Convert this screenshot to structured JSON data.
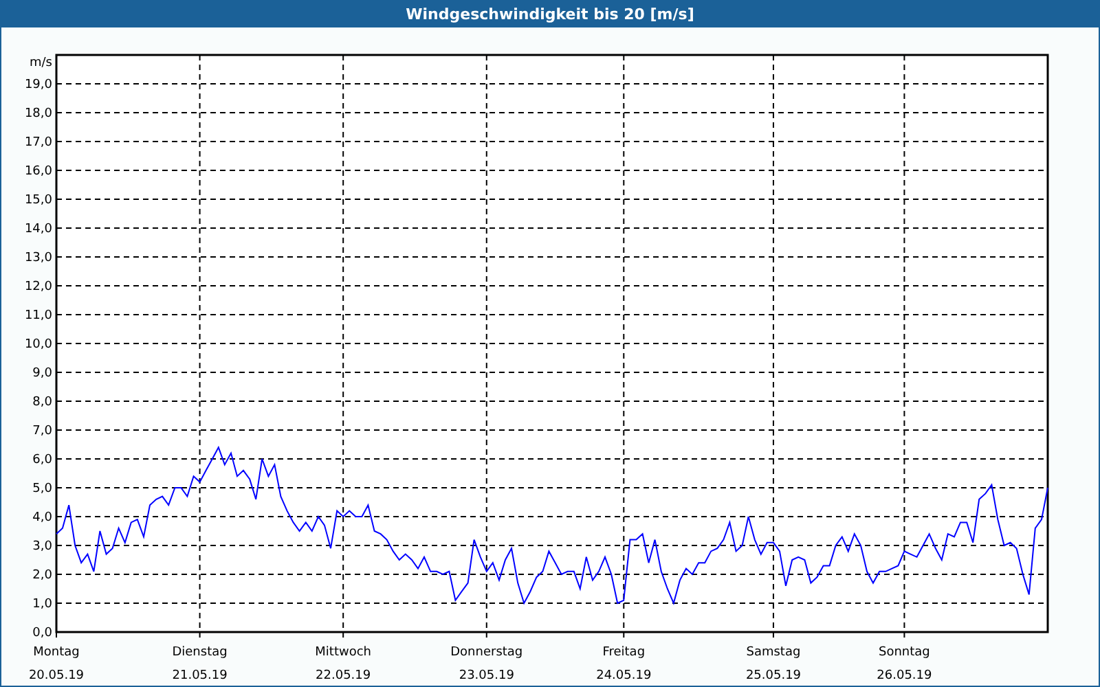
{
  "window": {
    "title": "Windgeschwindigkeit bis 20 [m/s]"
  },
  "chart": {
    "day_labels": [
      "Montag",
      "Dienstag",
      "Mittwoch",
      "Donnerstag",
      "Freitag",
      "Samstag",
      "Sonntag"
    ],
    "chart_data": {
      "type": "line",
      "ylabel": "m/s",
      "ylim": [
        0,
        20
      ],
      "grid": true,
      "categories": [
        "20.05.19",
        null,
        null,
        null,
        null,
        null,
        null,
        null,
        null,
        null,
        null,
        null,
        null,
        null,
        null,
        null,
        null,
        null,
        null,
        null,
        null,
        null,
        null,
        "21.05.19",
        null,
        null,
        null,
        null,
        null,
        null,
        null,
        null,
        null,
        null,
        null,
        null,
        null,
        null,
        null,
        null,
        null,
        null,
        null,
        null,
        null,
        null,
        "22.05.19",
        null,
        null,
        null,
        null,
        null,
        null,
        null,
        null,
        null,
        null,
        null,
        null,
        null,
        null,
        null,
        null,
        null,
        null,
        null,
        null,
        null,
        null,
        "23.05.19",
        null,
        null,
        null,
        null,
        null,
        null,
        null,
        null,
        null,
        null,
        null,
        null,
        null,
        null,
        null,
        null,
        null,
        null,
        null,
        null,
        null,
        "24.05.19",
        null,
        null,
        null,
        null,
        null,
        null,
        null,
        null,
        null,
        null,
        null,
        null,
        null,
        null,
        null,
        null,
        null,
        null,
        null,
        null,
        null,
        null,
        null,
        "25.05.19",
        null,
        null,
        null,
        null,
        null,
        null,
        null,
        null,
        null,
        null,
        null,
        null,
        null,
        null,
        null,
        null,
        null,
        null,
        null,
        null,
        "26.05.19",
        null,
        null,
        null,
        null,
        null,
        null,
        null,
        null,
        null,
        null,
        null,
        null,
        null,
        null,
        null,
        null,
        null,
        null,
        null,
        null,
        null,
        null,
        null
      ],
      "yticks": [
        {
          "value": 0,
          "label": "0,0"
        },
        {
          "value": 1,
          "label": "1,0"
        },
        {
          "value": 2,
          "label": "2,0"
        },
        {
          "value": 3,
          "label": "3,0"
        },
        {
          "value": 4,
          "label": "4,0"
        },
        {
          "value": 5,
          "label": "5,0"
        },
        {
          "value": 6,
          "label": "6,0"
        },
        {
          "value": 7,
          "label": "7,0"
        },
        {
          "value": 8,
          "label": "8,0"
        },
        {
          "value": 9,
          "label": "9,0"
        },
        {
          "value": 10,
          "label": "10,0"
        },
        {
          "value": 11,
          "label": "11,0"
        },
        {
          "value": 12,
          "label": "12,0"
        },
        {
          "value": 13,
          "label": "13,0"
        },
        {
          "value": 14,
          "label": "14,0"
        },
        {
          "value": 15,
          "label": "15,0"
        },
        {
          "value": 16,
          "label": "16,0"
        },
        {
          "value": 17,
          "label": "17,0"
        },
        {
          "value": 18,
          "label": "18,0"
        },
        {
          "value": 19,
          "label": "19,0"
        }
      ],
      "series": [
        {
          "color": "#0000ff",
          "values": [
            3.4,
            3.6,
            4.4,
            3.0,
            2.4,
            2.7,
            2.1,
            3.5,
            2.7,
            2.9,
            3.6,
            3.1,
            3.8,
            3.9,
            3.3,
            4.4,
            4.6,
            4.7,
            4.4,
            5.0,
            5.0,
            4.7,
            5.4,
            5.2,
            5.6,
            6.0,
            6.4,
            5.8,
            6.2,
            5.4,
            5.6,
            5.3,
            4.6,
            6.0,
            5.4,
            5.8,
            4.7,
            4.2,
            3.8,
            3.5,
            3.8,
            3.5,
            4.0,
            3.7,
            2.9,
            4.2,
            4.0,
            4.2,
            4.0,
            4.0,
            4.4,
            3.5,
            3.4,
            3.2,
            2.8,
            2.5,
            2.7,
            2.5,
            2.2,
            2.6,
            2.1,
            2.1,
            2.0,
            2.1,
            1.1,
            1.4,
            1.7,
            3.2,
            2.6,
            2.1,
            2.4,
            1.8,
            2.5,
            2.9,
            1.7,
            1.0,
            1.4,
            1.9,
            2.1,
            2.8,
            2.4,
            2.0,
            2.1,
            2.1,
            1.5,
            2.6,
            1.8,
            2.1,
            2.6,
            2.0,
            1.0,
            1.1,
            3.2,
            3.2,
            3.4,
            2.4,
            3.2,
            2.1,
            1.5,
            1.0,
            1.8,
            2.2,
            2.0,
            2.4,
            2.4,
            2.8,
            2.9,
            3.2,
            3.8,
            2.8,
            3.0,
            4.0,
            3.2,
            2.7,
            3.1,
            3.1,
            2.8,
            1.6,
            2.5,
            2.6,
            2.5,
            1.7,
            1.9,
            2.3,
            2.3,
            3.0,
            3.3,
            2.8,
            3.4,
            3.0,
            2.1,
            1.7,
            2.1,
            2.1,
            2.2,
            2.3,
            2.8,
            2.7,
            2.6,
            3.0,
            3.4,
            2.9,
            2.5,
            3.4,
            3.3,
            3.8,
            3.8,
            3.1,
            4.6,
            4.8,
            5.1,
            3.9,
            3.0,
            3.1,
            2.9,
            2.0,
            1.3,
            3.6,
            3.9,
            5.0
          ]
        }
      ]
    }
  }
}
